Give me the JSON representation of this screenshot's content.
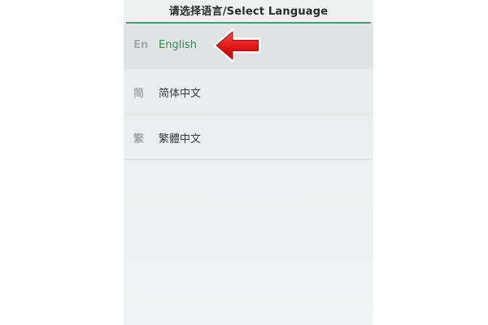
{
  "header": {
    "title": "请选择语言/Select Language"
  },
  "languages": [
    {
      "abbr": "En",
      "label": "English",
      "selected": true
    },
    {
      "abbr": "简",
      "label": "简体中文",
      "selected": false
    },
    {
      "abbr": "繁",
      "label": "繁體中文",
      "selected": false
    }
  ],
  "colors": {
    "accent": "#3fa06d",
    "selected_text": "#2e8f52",
    "arrow": "#e02020"
  },
  "icons": {
    "pointer": "red-arrow-left-icon"
  }
}
